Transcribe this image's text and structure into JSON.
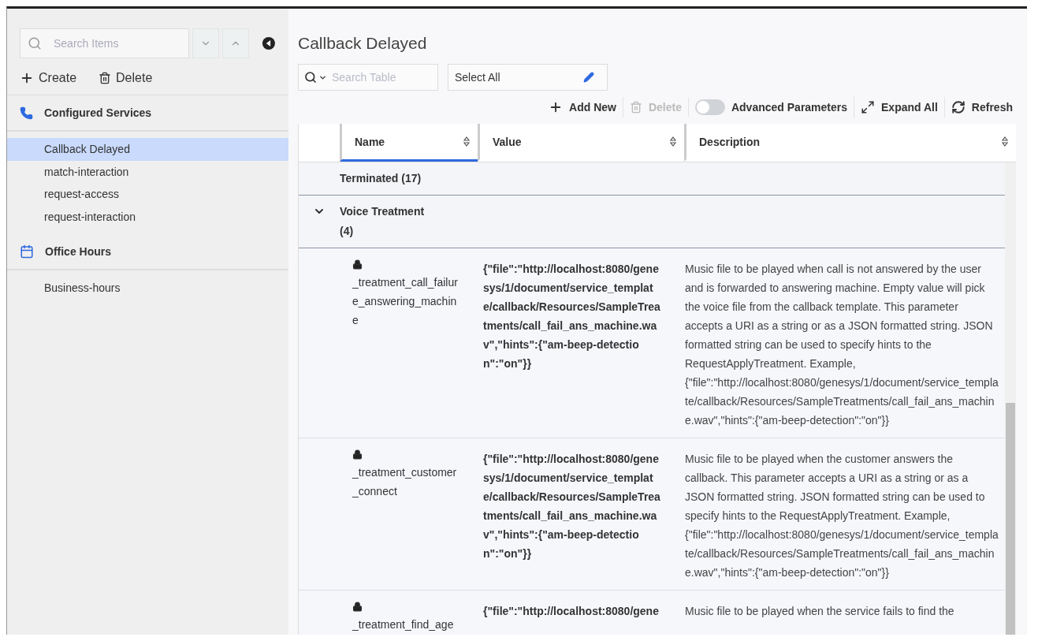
{
  "sidebar": {
    "search": {
      "placeholder": "Search Items"
    },
    "actions": [
      {
        "kind": "create",
        "label": "Create"
      },
      {
        "kind": "delete",
        "label": "Delete"
      }
    ],
    "groups": [
      {
        "kind": "phone",
        "title": "Configured Services",
        "items": [
          {
            "label": "Callback Delayed",
            "selected": true
          },
          {
            "label": "match-interaction",
            "selected": false
          },
          {
            "label": "request-access",
            "selected": false
          },
          {
            "label": "request-interaction",
            "selected": false
          }
        ]
      },
      {
        "kind": "calendar",
        "title": "Office Hours",
        "items": [
          {
            "label": "Business-hours",
            "selected": false
          }
        ]
      }
    ]
  },
  "main": {
    "title": "Callback Delayed",
    "search": {
      "placeholder": "Search Table"
    },
    "select": {
      "value": "Select All"
    },
    "toolbar": [
      {
        "kind": "add",
        "label": "Add New",
        "disabled": false
      },
      {
        "kind": "delete",
        "label": "Delete",
        "disabled": true
      },
      {
        "kind": "toggle",
        "label": "Advanced Parameters",
        "on": false
      },
      {
        "kind": "expand",
        "label": "Expand All",
        "disabled": false
      },
      {
        "kind": "refresh",
        "label": "Refresh",
        "disabled": false
      }
    ],
    "table": {
      "columns": [
        {
          "label": "Name",
          "selected": true
        },
        {
          "label": "Value",
          "selected": false
        },
        {
          "label": "Description",
          "selected": false
        }
      ],
      "groups": [
        {
          "label": "Terminated (17)",
          "expanded": false
        },
        {
          "label": "Voice Treatment (4)",
          "expanded": true,
          "rows": [
            {
              "locked": true,
              "name": "_treatment_call_failure_answering_machine",
              "value": "{\"file\":\"http://localhost:8080/genesys/1/document/service_template/callback/Resources/SampleTreatments/call_fail_ans_machine.wav\",\"hints\":{\"am-beep-detection\":\"on\"}}",
              "description": "Music file to be played when call is not answered by the user and is forwarded to answering machine. Empty value will pick the voice file from the callback template. This parameter accepts a URI as a string or as a JSON formatted string. JSON formatted string can be used to specify hints to the RequestApplyTreatment. Example, {\"file\":\"http://localhost:8080/genesys/1/document/service_template/callback/Resources/SampleTreatments/call_fail_ans_machine.wav\",\"hints\":{\"am-beep-detection\":\"on\"}}"
            },
            {
              "locked": true,
              "name": "_treatment_customer_connect",
              "value": "{\"file\":\"http://localhost:8080/genesys/1/document/service_template/callback/Resources/SampleTreatments/call_fail_ans_machine.wav\",\"hints\":{\"am-beep-detection\":\"on\"}}",
              "description": "Music file to be played when the customer answers the callback. This parameter accepts a URI as a string or as a JSON formatted string. JSON formatted string can be used to specify hints to the RequestApplyTreatment. Example, {\"file\":\"http://localhost:8080/genesys/1/document/service_template/callback/Resources/SampleTreatments/call_fail_ans_machine.wav\",\"hints\":{\"am-beep-detection\":\"on\"}}"
            },
            {
              "locked": true,
              "name": "_treatment_find_age",
              "value": "{\"file\":\"http://localhost:8080/gene",
              "description": "Music file to be played when the service fails to find the"
            }
          ]
        }
      ]
    }
  }
}
